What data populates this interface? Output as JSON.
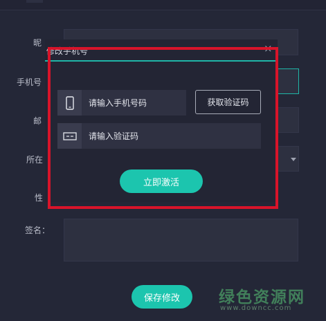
{
  "form": {
    "fields": [
      {
        "label": "昵",
        "name": "nickname"
      },
      {
        "label": "手机号",
        "name": "phone"
      },
      {
        "label": "邮",
        "name": "email"
      },
      {
        "label": "所在",
        "name": "location"
      },
      {
        "label": "性",
        "name": "gender"
      },
      {
        "label": "签名：",
        "name": "signature"
      }
    ],
    "save_label": "保存修改"
  },
  "modal": {
    "title": "修改手机号",
    "close_glyph": "×",
    "phone_placeholder": "请输入手机号码",
    "get_code_label": "获取验证码",
    "code_placeholder": "请输入验证码",
    "activate_label": "立即激活"
  },
  "watermark": {
    "main": "绿色资源网",
    "url": "www.downcc.com"
  },
  "colors": {
    "accent": "#1cc5ae",
    "highlight": "#d8142a",
    "background": "#242737"
  },
  "icons": {
    "phone": "phone-icon",
    "code": "card-icon",
    "close": "close-icon",
    "dropdown": "chevron-down-icon"
  }
}
